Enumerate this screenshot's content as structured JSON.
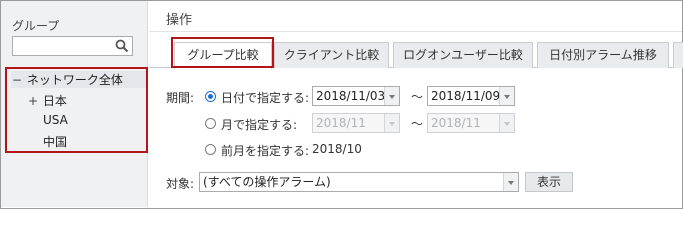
{
  "sidebar": {
    "title": "グループ",
    "search": {
      "value": "",
      "placeholder": ""
    },
    "tree": [
      {
        "toggle": "−",
        "label": "ネットワーク全体"
      },
      {
        "toggle": "+",
        "label": "日本"
      },
      {
        "toggle": "",
        "label": "USA"
      },
      {
        "toggle": "",
        "label": "中国"
      }
    ]
  },
  "main": {
    "title": "操作",
    "tabs": [
      {
        "label": "グループ比較",
        "selected": true
      },
      {
        "label": "クライアント比較"
      },
      {
        "label": "ログオンユーザー比較"
      },
      {
        "label": "日付別アラーム推移"
      },
      {
        "label": ""
      }
    ],
    "period": {
      "label": "期間:",
      "options": [
        {
          "label": "日付で指定する:",
          "selected": true,
          "from": "2018/11/03",
          "to": "2018/11/09"
        },
        {
          "label": "月で指定する:",
          "selected": false,
          "from": "2018/11",
          "to": "2018/11"
        },
        {
          "label": "前月を指定する:",
          "selected": false,
          "value": "2018/10"
        }
      ],
      "separator": "〜"
    },
    "target": {
      "label": "対象:",
      "value": "(すべての操作アラーム)",
      "show_button": "表示"
    }
  }
}
